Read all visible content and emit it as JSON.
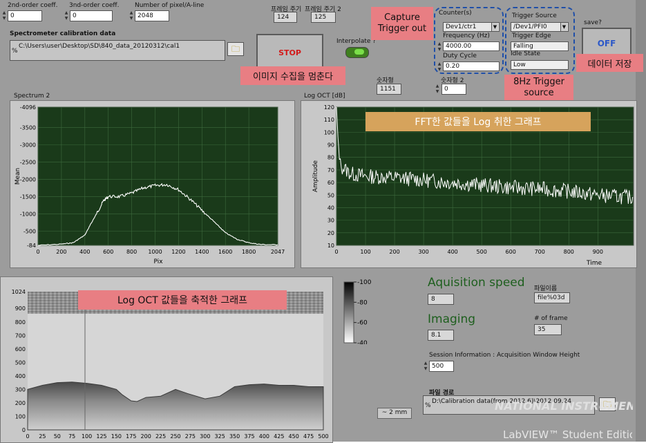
{
  "top_controls": {
    "coeff2_label": "2nd-order coeff.",
    "coeff2_value": "0",
    "coeff3_label": "3nd-order coeff.",
    "coeff3_value": "0",
    "pixels_label": "Number of pixel/A-line",
    "pixels_value": "2048",
    "frame_period_label": "프레임 주기",
    "frame_period_value": "124",
    "frame_period2_label": "프레임 주기 2",
    "frame_period2_value": "125"
  },
  "calibration": {
    "label": "Spectrometer calibration data",
    "path": "C:\\Users\\user\\Desktop\\SD\\840_data_20120312\\cal1",
    "path_prefix": "%"
  },
  "stop_button": {
    "label": "STOP"
  },
  "stop_note": "이미지 수집을 멈춘다",
  "interpolate": {
    "label": "Interpolate ?"
  },
  "capture_note": "Capture\nTrigger out",
  "counter": {
    "label": "Counter(s)",
    "value": "Dev1/ctr1",
    "frequency_label": "Frequency (Hz)",
    "frequency_value": "4000.00",
    "duty_label": "Duty Cycle",
    "duty_value": "0.20"
  },
  "trigger": {
    "label": "Trigger Source",
    "value": "/Dev1/PFI0",
    "edge_label": "Trigger Edge",
    "edge_value": "Falling",
    "idle_label": "Idle State",
    "idle_value": "Low",
    "note": "8Hz Trigger\nsource"
  },
  "save": {
    "label": "save?",
    "button": "OFF",
    "note": "데이터 저장"
  },
  "counts": {
    "count1_label": "숫자형",
    "count1_value": "1151",
    "count2_label": "숫자형 2",
    "count2_value": "0"
  },
  "spectrum": {
    "title": "Spectrum 2",
    "ylabel": "Mean",
    "xlabel": "Pix"
  },
  "logoct": {
    "title": "Log OCT [dB]",
    "ylabel": "Amplitude",
    "xlabel": "Time",
    "note": "FFT한 값들을 Log 취한 그래프"
  },
  "intensity": {
    "note": "Log OCT 값들을 축적한 그래프",
    "scale_ticks": [
      "100",
      "80",
      "60",
      "40"
    ],
    "scalebar": "~ 2 mm"
  },
  "right_info": {
    "acq_speed_label": "Aquisition speed",
    "acq_speed_value": "8",
    "imaging_label": "Imaging",
    "imaging_value": "8.1",
    "filename_label": "파일이름",
    "filename_value": "file%03d",
    "frames_label": "# of frame",
    "frames_value": "35",
    "session_label": "Session Information : Acquisition Window Height",
    "session_value": "500",
    "filepath_label": "파일 경로",
    "filepath_value": "D:\\Calibration data(from 2012.6)\\2012.09.24"
  },
  "branding": {
    "ni": "NATIONAL INSTRUMENTS",
    "labview": "LabVIEW™ Student Edition"
  },
  "chart_data": [
    {
      "type": "line",
      "title": "Spectrum 2",
      "xlabel": "Pix",
      "ylabel": "Mean",
      "xlim": [
        0,
        2047
      ],
      "ylim": [
        -4096,
        -84
      ],
      "x_ticks": [
        "0",
        "200",
        "400",
        "600",
        "800",
        "1000",
        "1200",
        "1400",
        "1600",
        "1800",
        "2047"
      ],
      "y_ticks": [
        "-4096",
        "-3500",
        "-3000",
        "-2500",
        "-2000",
        "-1500",
        "-1000",
        "-500",
        "-84"
      ],
      "x": [
        0,
        200,
        300,
        400,
        450,
        500,
        560,
        600,
        700,
        800,
        900,
        1000,
        1100,
        1200,
        1300,
        1400,
        1500,
        1600,
        1700,
        1800,
        1900,
        2047
      ],
      "y": [
        -84,
        -120,
        -160,
        -380,
        -700,
        -1000,
        -1380,
        -1500,
        -1500,
        -1600,
        -1750,
        -1820,
        -1850,
        -1700,
        -1420,
        -1100,
        -780,
        -450,
        -260,
        -160,
        -110,
        -100
      ]
    },
    {
      "type": "line",
      "title": "Log OCT [dB]",
      "xlabel": "Time",
      "ylabel": "Amplitude",
      "xlim": [
        0,
        1023
      ],
      "ylim": [
        10,
        120
      ],
      "x_ticks": [
        "0",
        "100",
        "200",
        "300",
        "400",
        "500",
        "600",
        "700",
        "800",
        "900"
      ],
      "y_ticks": [
        "10",
        "20",
        "30",
        "40",
        "50",
        "60",
        "70",
        "80",
        "90",
        "100",
        "110",
        "120"
      ],
      "x": [
        0,
        5,
        10,
        20,
        50,
        100,
        200,
        300,
        400,
        500,
        600,
        700,
        800,
        900,
        1023
      ],
      "y": [
        120,
        95,
        80,
        72,
        67,
        65,
        64,
        62,
        60,
        58,
        56,
        55,
        53,
        50,
        48
      ]
    },
    {
      "type": "heatmap",
      "x_ticks": [
        "0",
        "25",
        "50",
        "75",
        "100",
        "125",
        "150",
        "175",
        "200",
        "225",
        "250",
        "275",
        "300",
        "325",
        "350",
        "375",
        "400",
        "425",
        "450",
        "475",
        "500"
      ],
      "y_ticks": [
        "1024",
        "900",
        "800",
        "700",
        "600",
        "500",
        "400",
        "300",
        "200",
        "100",
        "0"
      ],
      "xlim": [
        0,
        500
      ],
      "ylim": [
        0,
        1024
      ],
      "colorbar_ticks": [
        "100",
        "80",
        "60",
        "40"
      ],
      "colorbar_range": [
        40,
        100
      ]
    }
  ]
}
